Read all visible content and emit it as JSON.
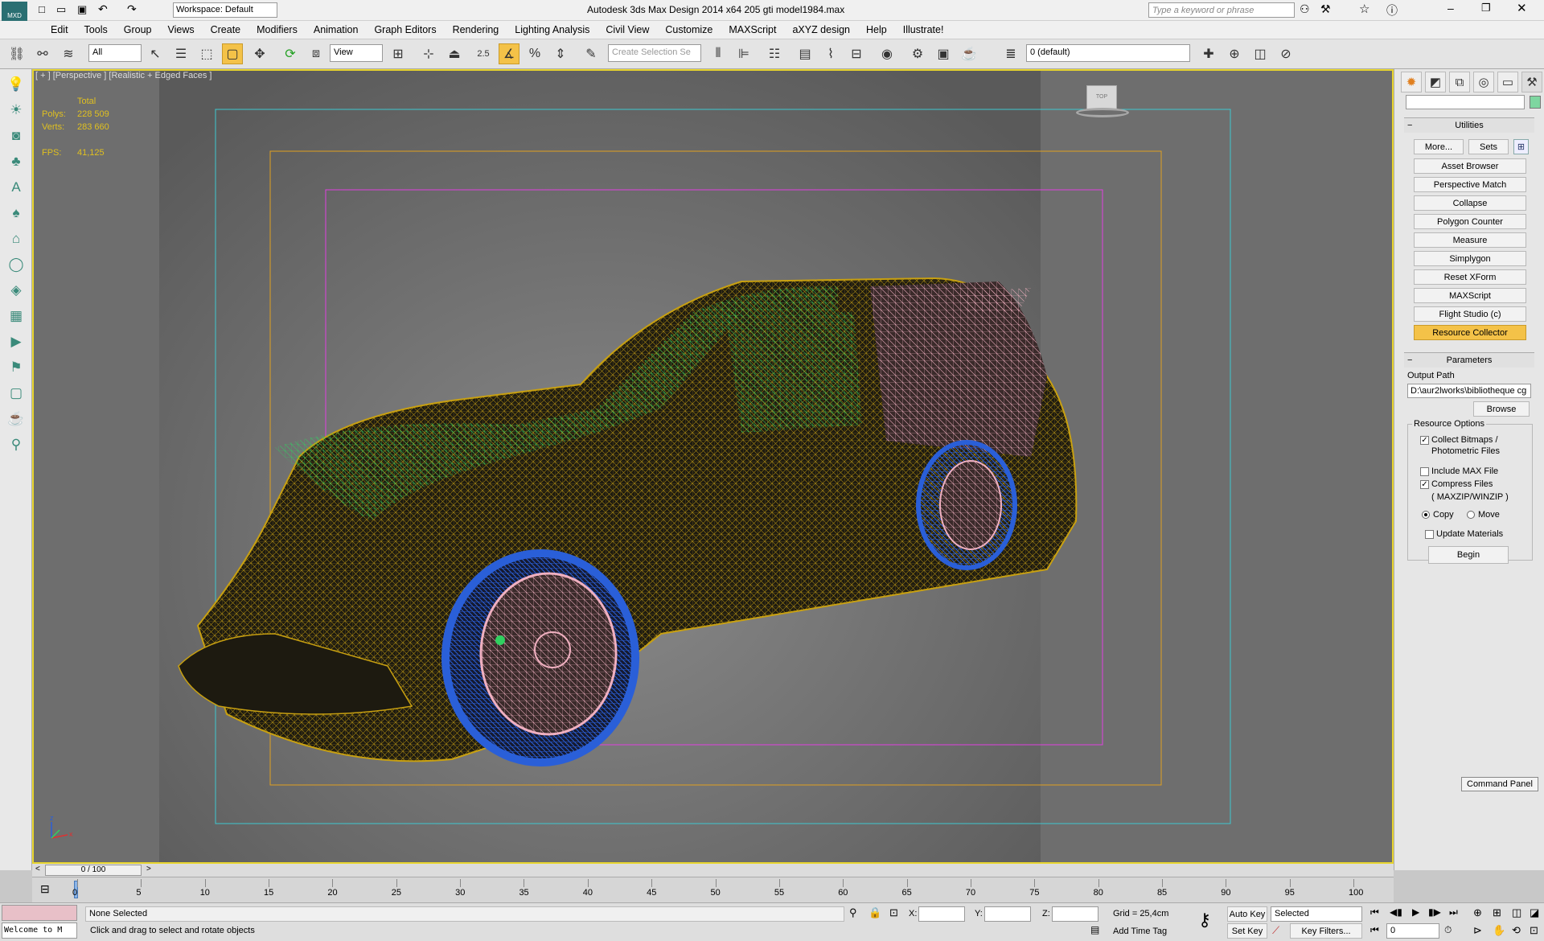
{
  "app": {
    "title": "Autodesk 3ds Max Design 2014 x64     205 gti model1984.max",
    "logo": "MXD",
    "workspace": "Workspace: Default",
    "search_placeholder": "Type a keyword or phrase"
  },
  "menu": [
    "Edit",
    "Tools",
    "Group",
    "Views",
    "Create",
    "Modifiers",
    "Animation",
    "Graph Editors",
    "Rendering",
    "Lighting Analysis",
    "Civil View",
    "Customize",
    "MAXScript",
    "aXYZ design",
    "Help",
    "Illustrate!"
  ],
  "toolbar": {
    "filter": "All",
    "ref_coord": "View",
    "selection_set_placeholder": "Create Selection Se",
    "layer": "0 (default)",
    "snap_value": "2.5"
  },
  "viewport": {
    "label": "[ + ] [Perspective ] [Realistic + Edged Faces ]",
    "stats_header": "Total",
    "polys_label": "Polys:",
    "polys_value": "228 509",
    "verts_label": "Verts:",
    "verts_value": "283 660",
    "fps_label": "FPS:",
    "fps_value": "41,125",
    "viewcube_face": "TOP",
    "colors": {
      "border": "#e8d52e",
      "bg": "#6e6e6e",
      "safe_outer": "#3ec8d0",
      "safe_mid": "#e0a020",
      "safe_inner": "#e040e0",
      "wire_body": "#c8a010",
      "wire_glass": "#30d060",
      "wire_tyre": "#2a5fd8",
      "wire_rim": "#f0b0c0"
    }
  },
  "command_panel": {
    "utilities_title": "Utilities",
    "more": "More...",
    "sets": "Sets",
    "buttons": [
      "Asset Browser",
      "Perspective Match",
      "Collapse",
      "Polygon Counter",
      "Measure",
      "Simplygon",
      "Reset XForm",
      "MAXScript",
      "Flight Studio (c)",
      "Resource Collector"
    ],
    "active_button": "Resource Collector",
    "params_title": "Parameters",
    "output_path_label": "Output Path",
    "output_path": "D:\\aur2lworks\\bibliotheque cg",
    "browse": "Browse",
    "options_title": "Resource Options",
    "collect_bitmaps": "Collect Bitmaps /",
    "collect_bitmaps_2": "Photometric Files",
    "include_max": "Include MAX File",
    "compress": "Compress Files",
    "compress_2": "( MAXZIP/WINZIP )",
    "copy": "Copy",
    "move": "Move",
    "update_materials": "Update Materials",
    "begin": "Begin",
    "tooltip": "Command Panel"
  },
  "timeline": {
    "frame": "0 / 100",
    "ticks": [
      "0",
      "5",
      "10",
      "15",
      "20",
      "25",
      "30",
      "35",
      "40",
      "45",
      "50",
      "55",
      "60",
      "65",
      "70",
      "75",
      "80",
      "85",
      "90",
      "95",
      "100"
    ]
  },
  "status": {
    "maxscript": "Welcome to M",
    "selection": "None Selected",
    "prompt": "Click and drag to select and rotate objects",
    "x_label": "X:",
    "y_label": "Y:",
    "z_label": "Z:",
    "grid": "Grid = 25,4cm",
    "add_time_tag": "Add Time Tag",
    "auto_key": "Auto Key",
    "set_key": "Set Key",
    "selected": "Selected",
    "key_filters": "Key Filters...",
    "current_frame": "0"
  }
}
